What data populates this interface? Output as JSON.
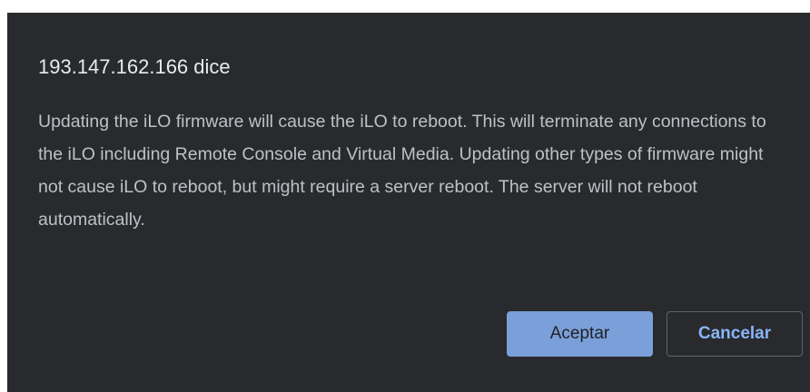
{
  "dialog": {
    "title": "193.147.162.166 dice",
    "message": "Updating the iLO firmware will cause the iLO to reboot. This will terminate any connections to the iLO including Remote Console and Virtual Media.  Updating other types of firmware might not cause iLO to reboot, but might require a server reboot.  The server will not reboot automatically.",
    "accept_label": "Aceptar",
    "cancel_label": "Cancelar"
  },
  "colors": {
    "dialog_background": "#292a2d",
    "accent": "#8ab4f8"
  }
}
